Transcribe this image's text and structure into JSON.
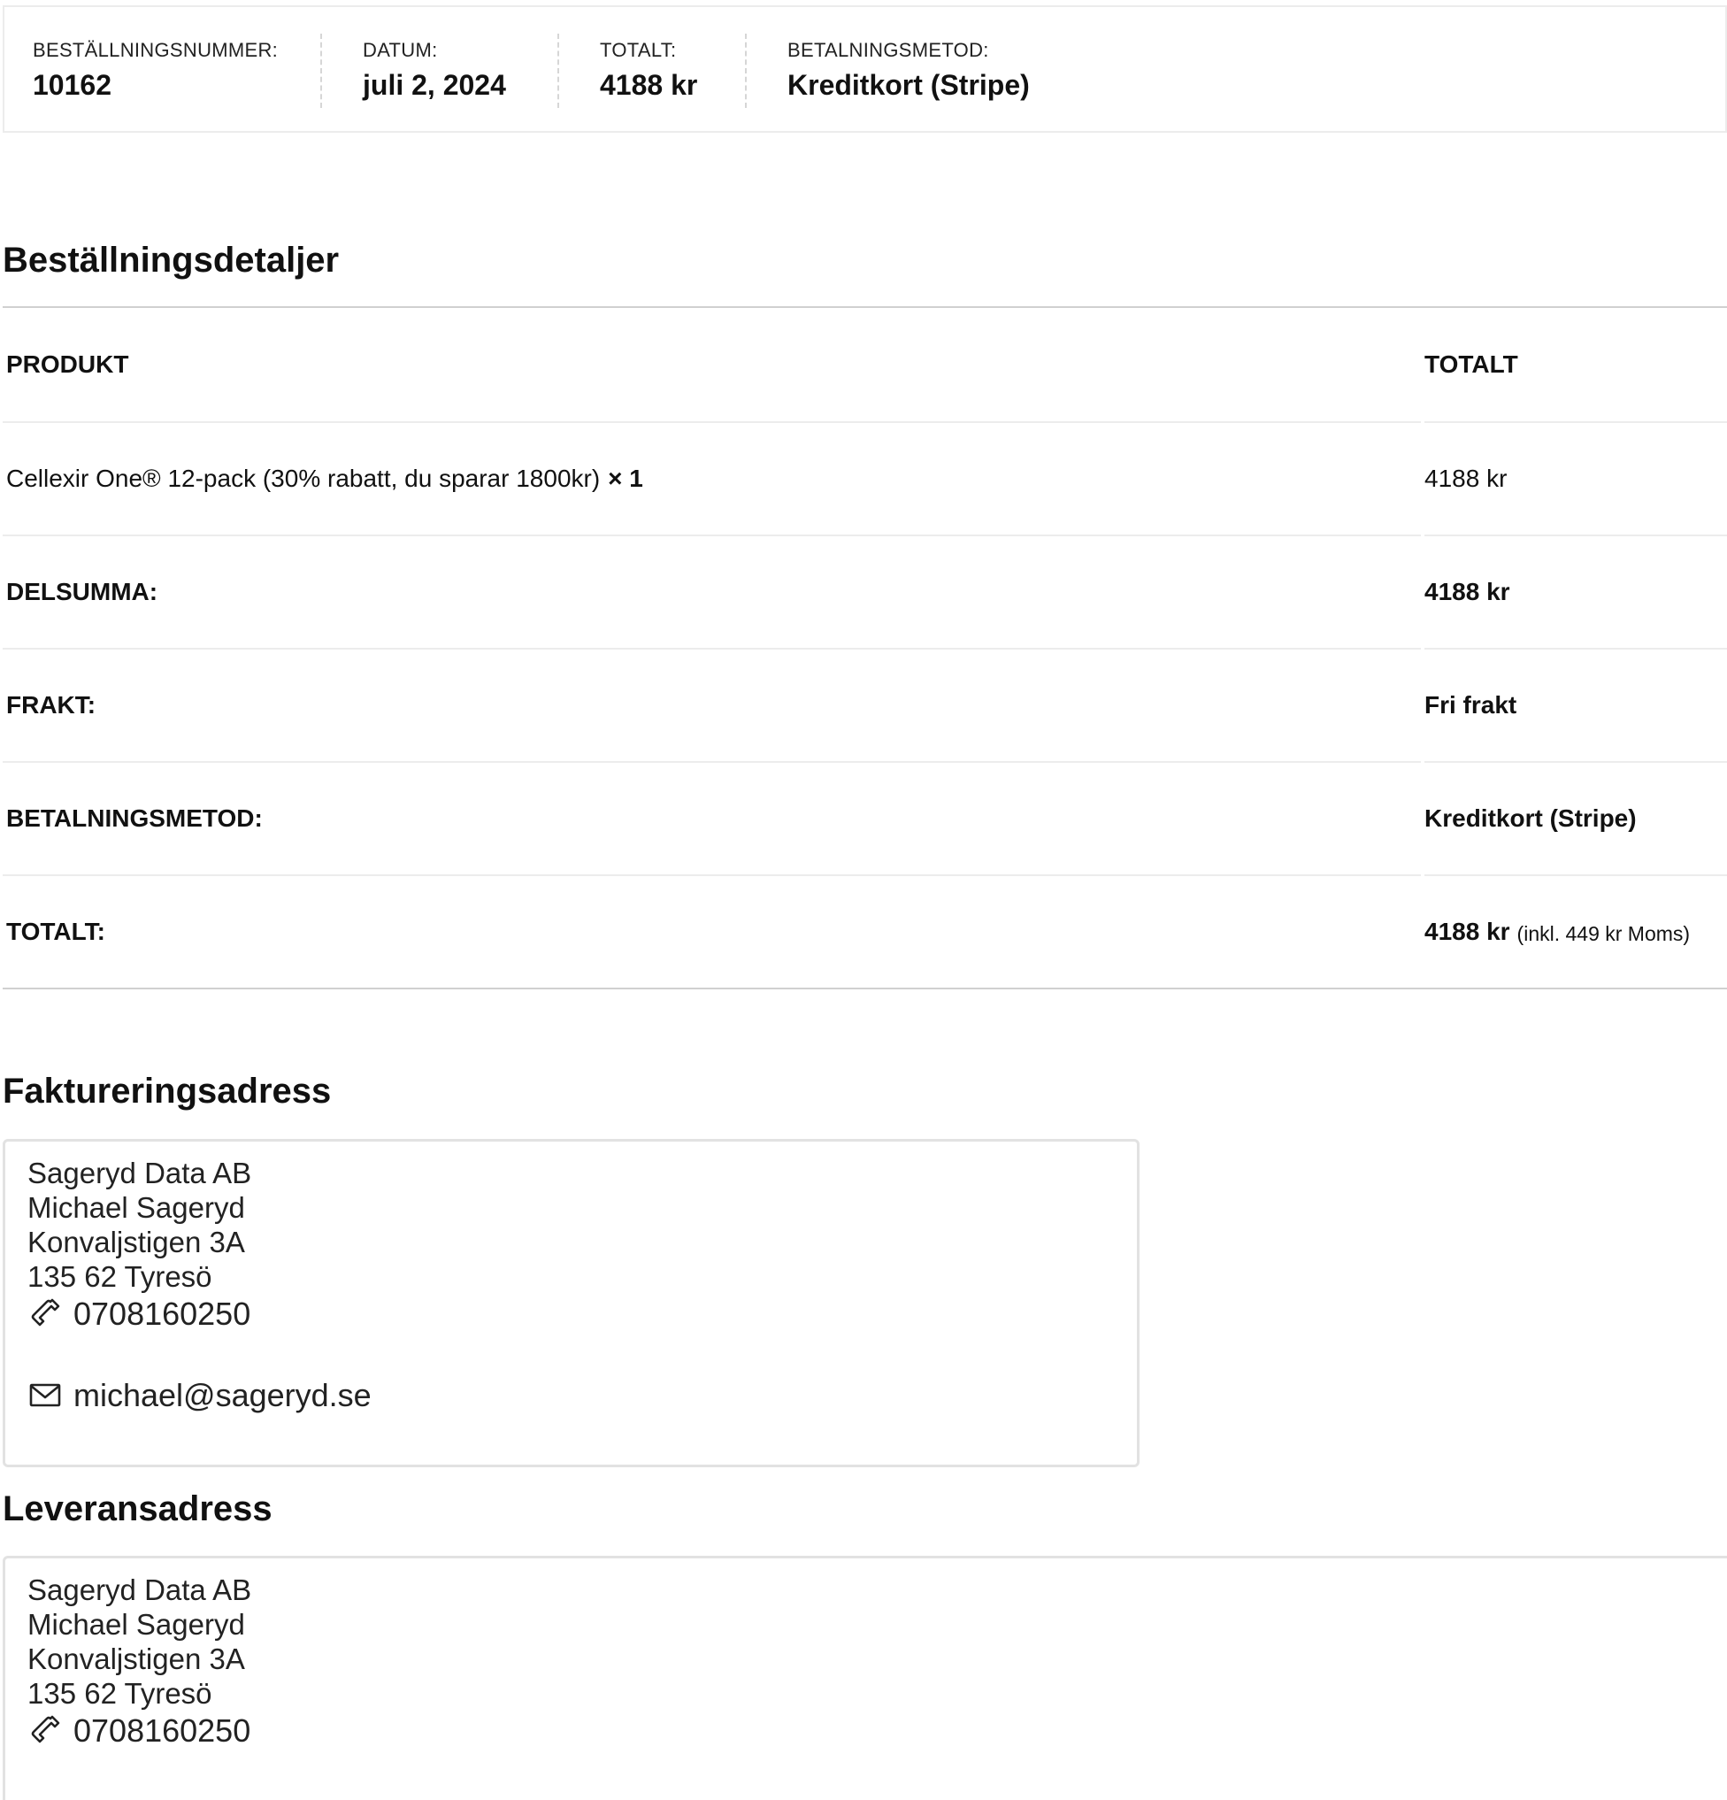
{
  "overview": {
    "order_number_label": "BESTÄLLNINGSNUMMER:",
    "order_number": "10162",
    "date_label": "DATUM:",
    "date": "juli 2, 2024",
    "total_label": "TOTALT:",
    "total": "4188 kr",
    "payment_label": "BETALNINGSMETOD:",
    "payment": "Kreditkort (Stripe)"
  },
  "order_details": {
    "title": "Beställningsdetaljer",
    "col_product": "PRODUKT",
    "col_total": "TOTALT",
    "items": [
      {
        "name": "Cellexir One® 12-pack (30% rabatt, du sparar 1800kr)",
        "qty": "× 1",
        "total": "4188 kr"
      }
    ],
    "subtotal_label": "DELSUMMA:",
    "subtotal": "4188 kr",
    "shipping_label": "FRAKT:",
    "shipping": "Fri frakt",
    "payment_label": "BETALNINGSMETOD:",
    "payment": "Kreditkort (Stripe)",
    "total_label": "TOTALT:",
    "total": "4188 kr",
    "tax_note": "(inkl. 449 kr Moms)"
  },
  "billing": {
    "title": "Faktureringsadress",
    "company": "Sageryd Data AB",
    "name": "Michael Sageryd",
    "street": "Konvaljstigen 3A",
    "postal": "135 62 Tyresö",
    "phone": "0708160250",
    "email": "michael@sageryd.se"
  },
  "shipping": {
    "title": "Leveransadress",
    "company": "Sageryd Data AB",
    "name": "Michael Sageryd",
    "street": "Konvaljstigen 3A",
    "postal": "135 62 Tyresö",
    "phone": "0708160250"
  }
}
